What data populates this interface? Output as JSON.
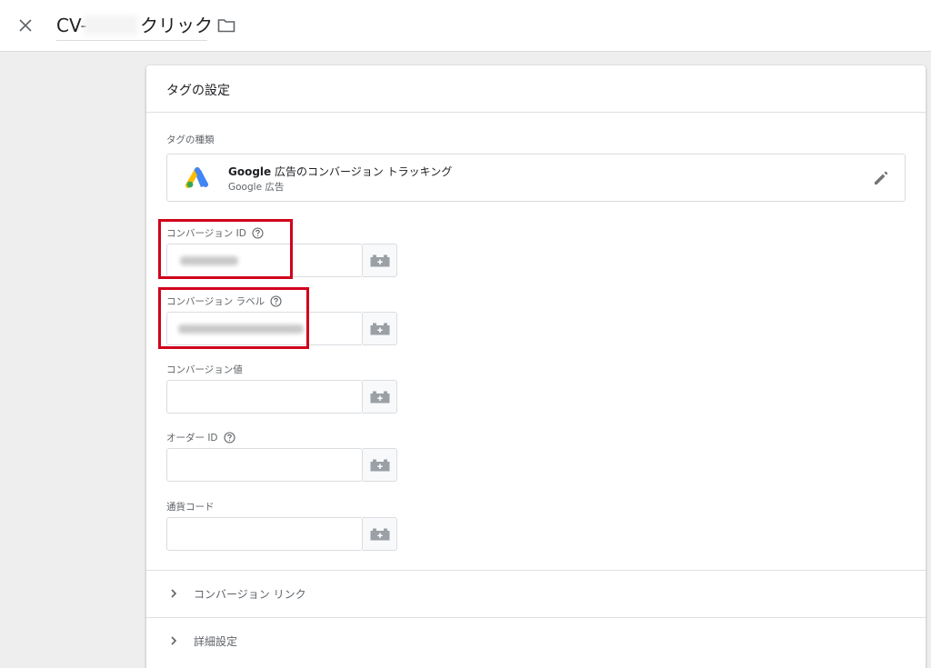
{
  "header": {
    "close_icon": "close-icon",
    "title_prefix": "CV-",
    "title_suffix": "クリック",
    "folder_icon": "folder-icon"
  },
  "card": {
    "title": "タグの設定",
    "tag_type": {
      "label": "タグの種類",
      "name_brand": "Google",
      "name_rest": " 広告のコンバージョン トラッキング",
      "subtitle": "Google 広告",
      "logo_icon": "google-ads-logo",
      "edit_icon": "pencil-icon"
    },
    "fields": [
      {
        "label": "コンバージョン ID",
        "value": "",
        "has_help": true
      },
      {
        "label": "コンバージョン ラベル",
        "value": "",
        "has_help": true
      },
      {
        "label": "コンバージョン値",
        "value": "",
        "has_help": false
      },
      {
        "label": "オーダー ID",
        "value": "",
        "has_help": true
      },
      {
        "label": "通貨コード",
        "value": "",
        "has_help": false
      }
    ],
    "variable_icon": "variable-brick-icon",
    "help_icon": "help-circle-icon",
    "sections": [
      {
        "label": "コンバージョン リンク"
      },
      {
        "label": "詳細設定"
      }
    ]
  },
  "colors": {
    "highlight": "#d0021b",
    "ads_blue": "#4285f4",
    "ads_yellow": "#fbbc04",
    "ads_green": "#34a853"
  }
}
